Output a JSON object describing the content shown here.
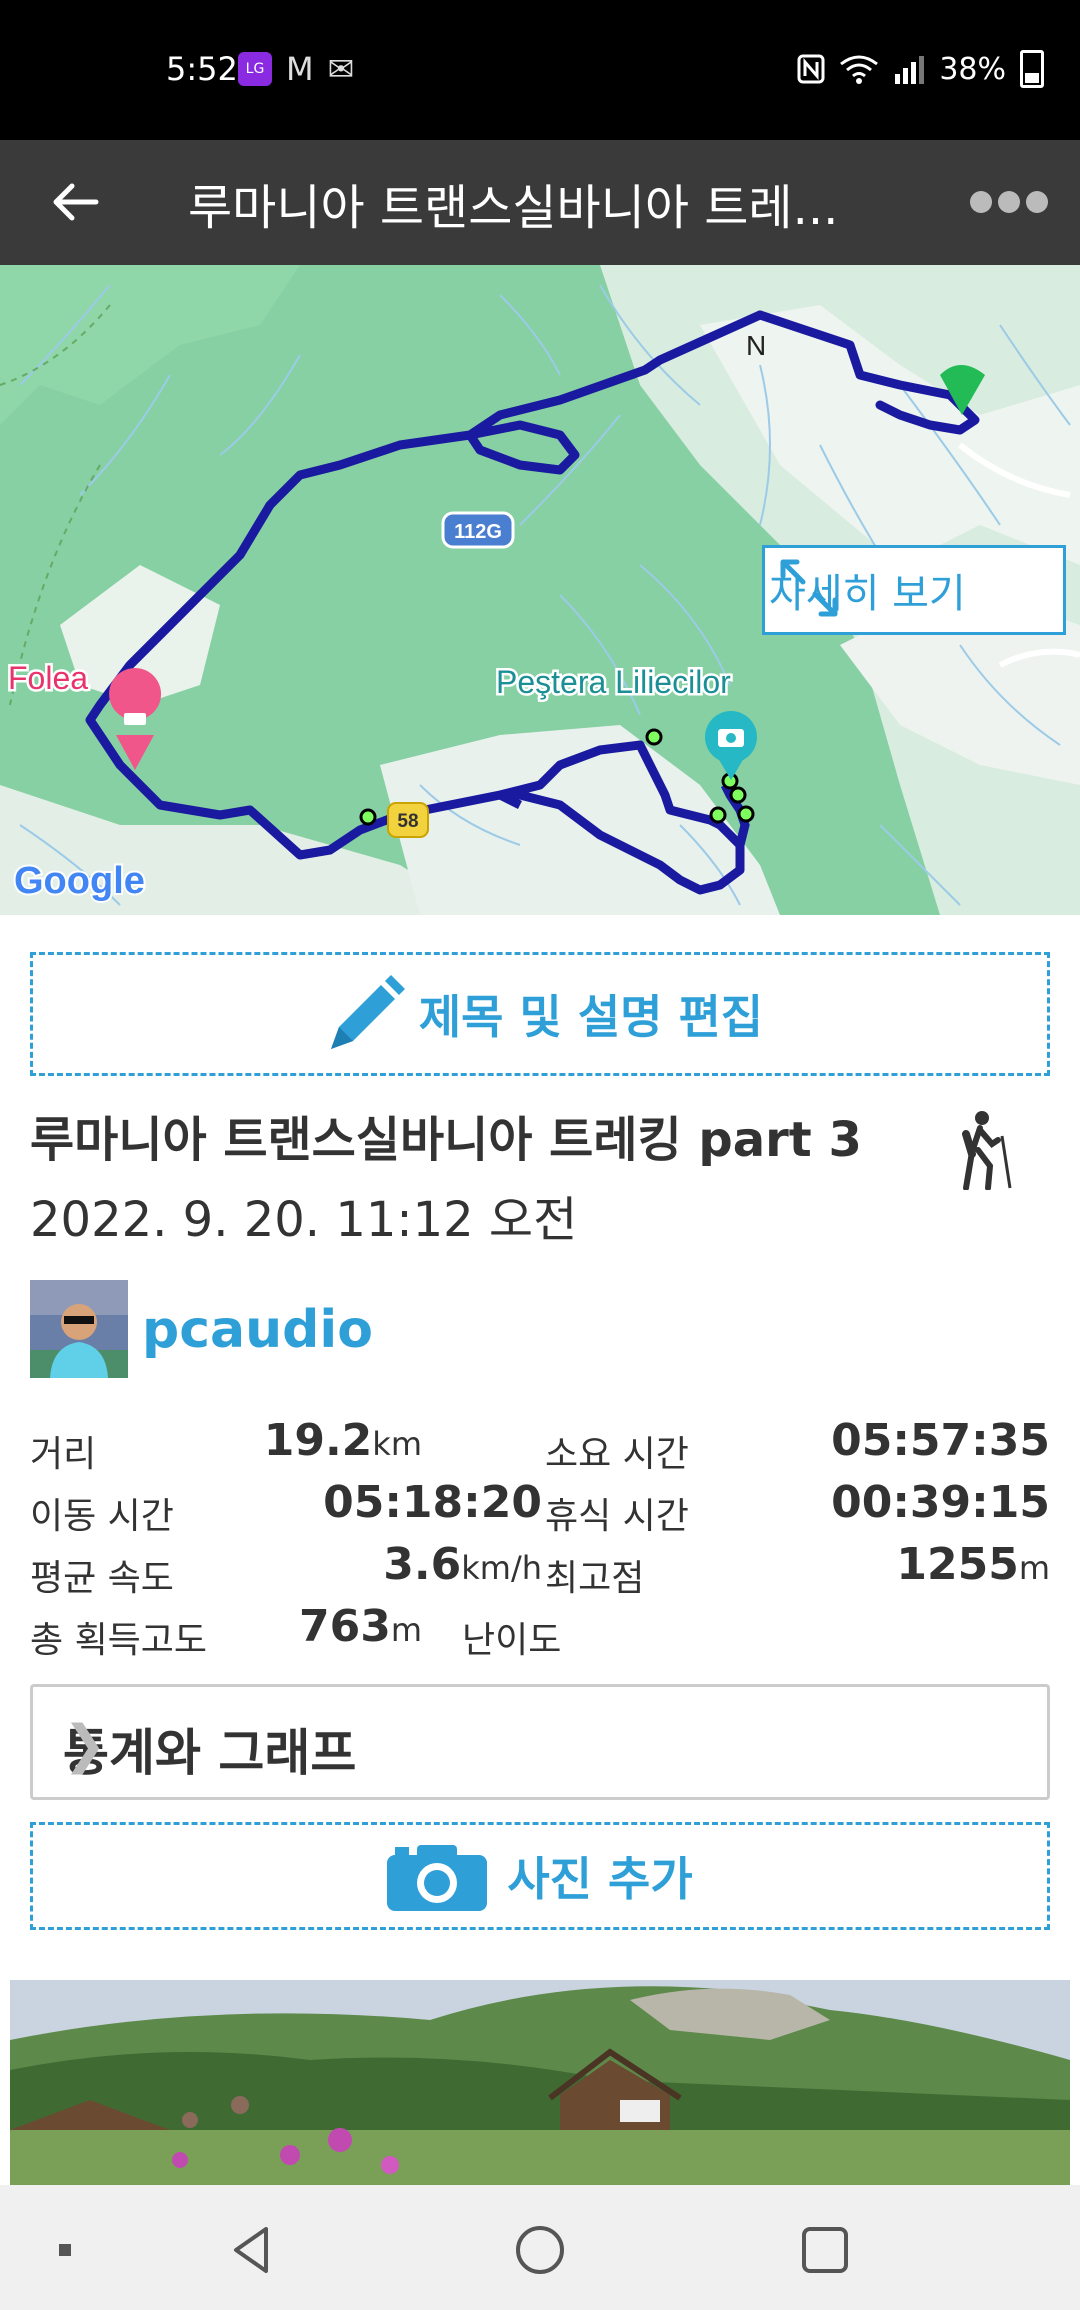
{
  "status_bar": {
    "time": "5:52",
    "battery": "38%",
    "lg_badge": "LG",
    "gmail_glyph": "M",
    "mail_glyph": "✉"
  },
  "app_bar": {
    "title": "루마니아 트랜스실바니아 트레..."
  },
  "map": {
    "detail_button": "자세히 보기",
    "labels": {
      "folea": "Folea",
      "cave": "Peştera Liliecilor",
      "road_112g": "112G",
      "road_58": "58",
      "google": "Google",
      "poi_m": "N"
    },
    "route_color": "#1a1aa0"
  },
  "edit_button": "제목 및 설명 편집",
  "track": {
    "title": "루마니아 트랜스실바니아 트레킹 part 3",
    "date": "2022. 9. 20. 11:12 오전",
    "activity_icon": "hiking-icon"
  },
  "user": {
    "name": "pcaudio"
  },
  "stats": {
    "distance_label": "거리",
    "distance_value": "19.2",
    "distance_unit": "km",
    "duration_label": "소요 시간",
    "duration_value": "05:57:35",
    "moving_label": "이동 시간",
    "moving_value": "05:18:20",
    "rest_label": "휴식 시간",
    "rest_value": "00:39:15",
    "avg_speed_label": "평균 속도",
    "avg_speed_value": "3.6",
    "avg_speed_unit": "km/h",
    "max_elev_label": "최고점",
    "max_elev_value": "1255",
    "max_elev_unit": "m",
    "gain_label": "총 획득고도",
    "gain_value": "763",
    "gain_unit": "m",
    "difficulty_label": "난이도"
  },
  "stats_graph_button": "통계와 그래프",
  "add_photo_button": "사진 추가",
  "colors": {
    "accent": "#2f9fd8",
    "appbar": "#3a3a3a"
  }
}
